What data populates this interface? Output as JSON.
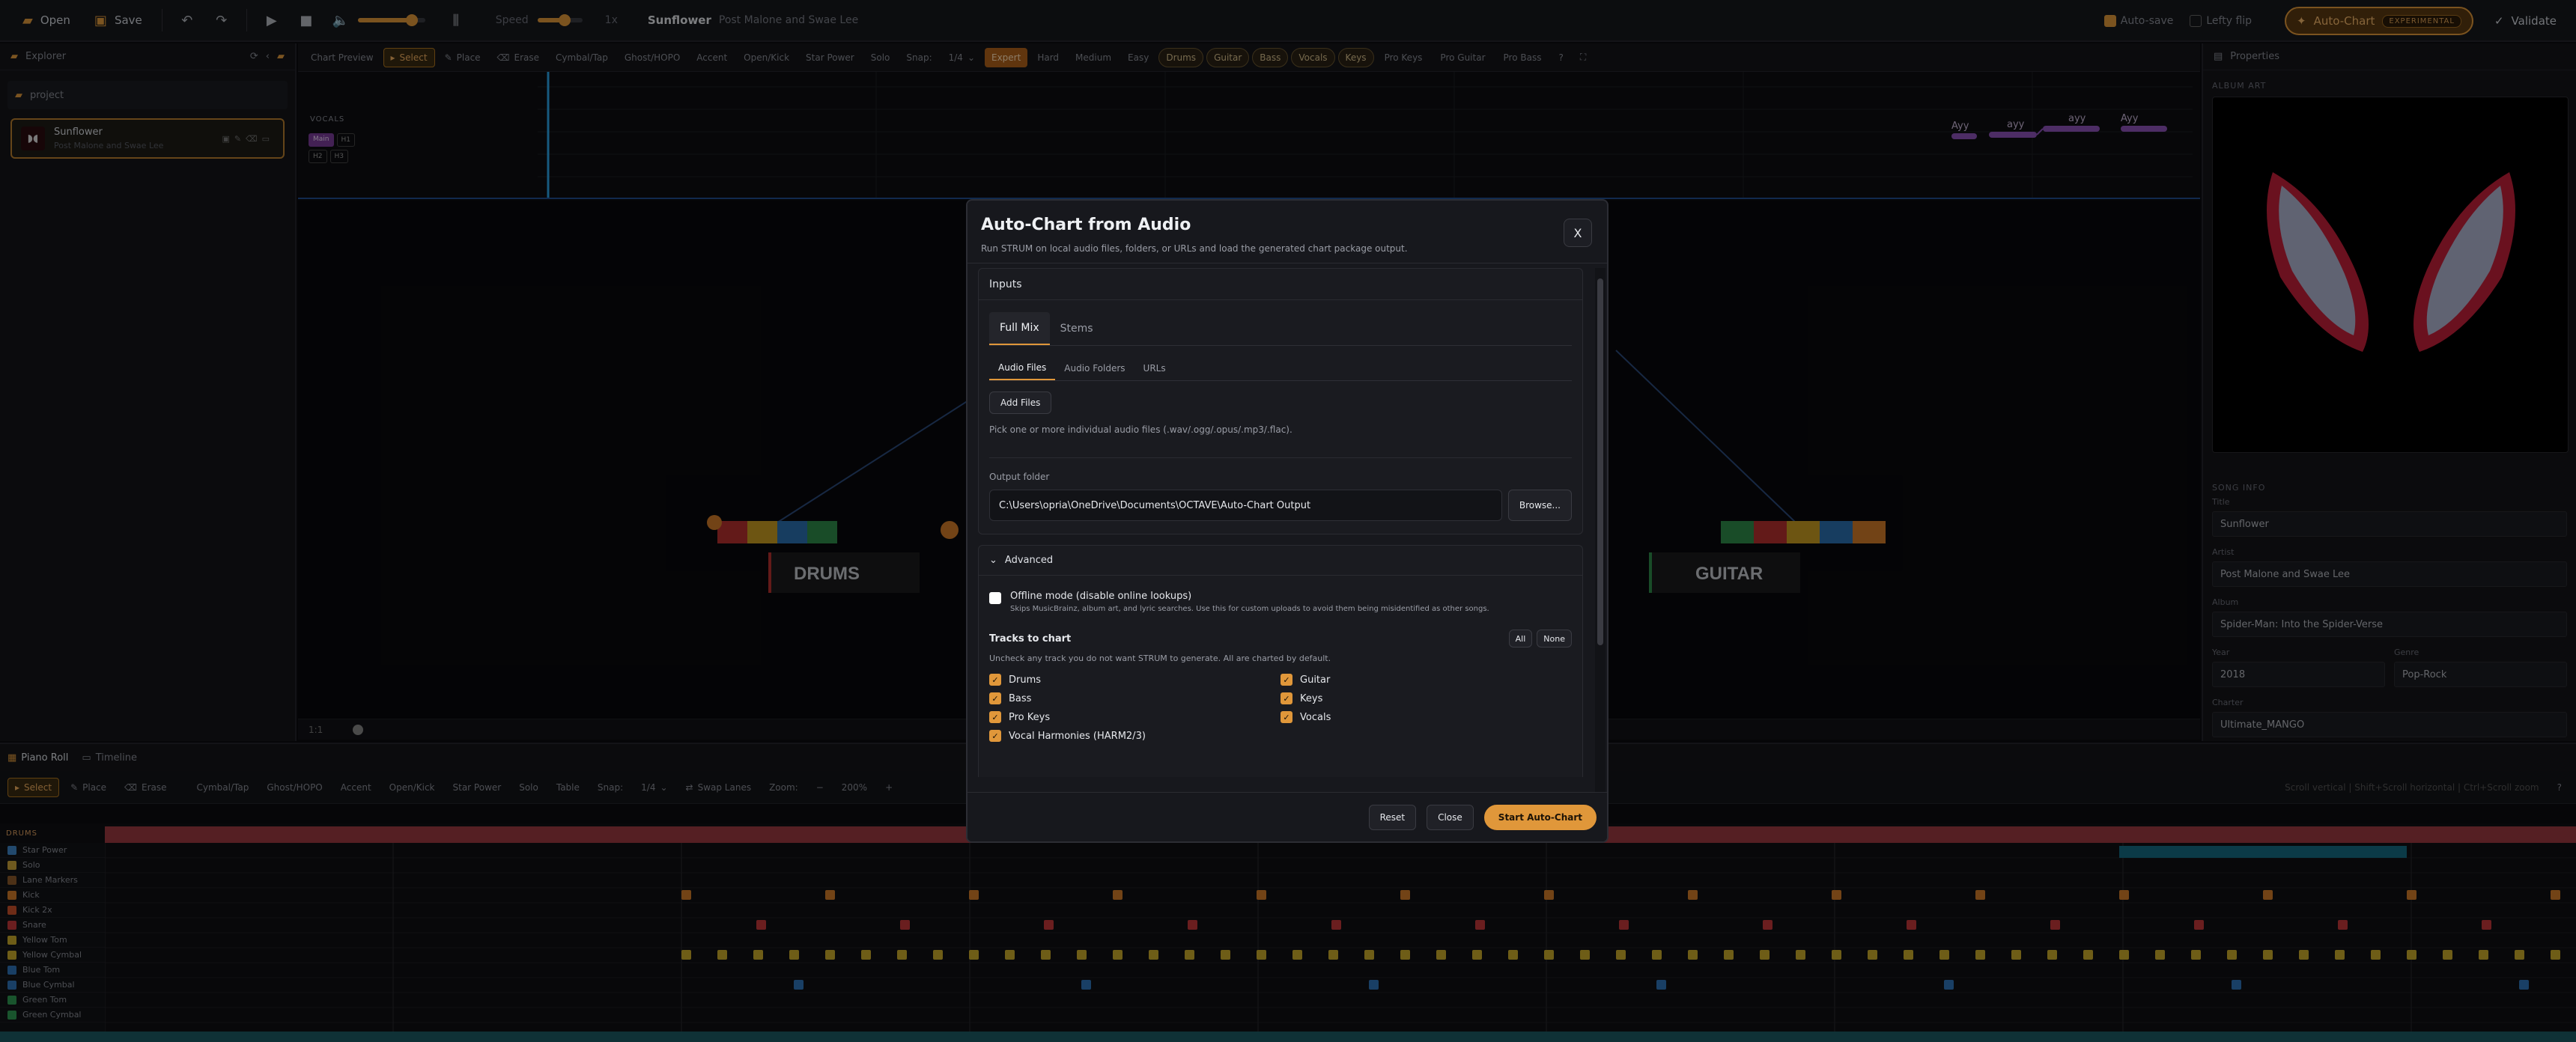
{
  "topbar": {
    "open": "Open",
    "save": "Save",
    "speed_label": "Speed",
    "speed_value": "1x",
    "song_title": "Sunflower",
    "song_artist": "Post Malone and Swae Lee",
    "auto_save": "Auto-save",
    "lefty_flip": "Lefty flip",
    "auto_chart": "Auto-Chart",
    "experimental": "EXPERIMENTAL",
    "validate": "Validate"
  },
  "explorer": {
    "title": "Explorer",
    "folder": "project",
    "song_title": "Sunflower",
    "song_artist": "Post Malone and Swae Lee"
  },
  "chartbar": {
    "title": "Chart Preview",
    "select": "Select",
    "place": "Place",
    "erase": "Erase",
    "cymbal_tap": "Cymbal/Tap",
    "ghost_hopo": "Ghost/HOPO",
    "accent": "Accent",
    "open_kick": "Open/Kick",
    "star_power": "Star Power",
    "solo": "Solo",
    "snap": "Snap:",
    "snap_value": "1/4",
    "expert": "Expert",
    "hard": "Hard",
    "medium": "Medium",
    "easy": "Easy",
    "tracks": [
      "Drums",
      "Guitar",
      "Bass",
      "Vocals",
      "Keys"
    ],
    "tracks_off": [
      "Pro Keys",
      "Pro Guitar",
      "Pro Bass"
    ]
  },
  "vocals": {
    "label": "VOCALS",
    "main": "Main",
    "h1": "H1",
    "h2": "H2",
    "h3": "H3",
    "lyrics": [
      "Ayy",
      "ayy",
      "ayy",
      "Ayy"
    ]
  },
  "highway": {
    "left": "DRUMS",
    "right": "GUITAR",
    "zoom": "1:1"
  },
  "props": {
    "title": "Properties",
    "album_art": "ALBUM ART",
    "song_info": "SONG INFO",
    "title_label": "Title",
    "title_value": "Sunflower",
    "artist_label": "Artist",
    "artist_value": "Post Malone and Swae Lee",
    "album_label": "Album",
    "album_value": "Spider-Man: Into the Spider-Verse",
    "year_label": "Year",
    "year_value": "2018",
    "genre_label": "Genre",
    "genre_value": "Pop-Rock",
    "charter_label": "Charter",
    "charter_value": "Ultimate_MANGO"
  },
  "bottom": {
    "piano_roll": "Piano Roll",
    "timeline": "Timeline",
    "select": "Select",
    "place": "Place",
    "erase": "Erase",
    "cymbal_tap": "Cymbal/Tap",
    "ghost_hopo": "Ghost/HOPO",
    "accent": "Accent",
    "open_kick": "Open/Kick",
    "star_power": "Star Power",
    "solo": "Solo",
    "table": "Table",
    "snap": "Snap:",
    "snap_value": "1/4",
    "swap_lanes": "Swap Lanes",
    "zoom": "Zoom:",
    "zoom_value": "200%",
    "hint": "Scroll vertical | Shift+Scroll horizontal | Ctrl+Scroll zoom",
    "section": "DRUMS",
    "lanes": [
      "Star Power",
      "Solo",
      "Lane Markers",
      "Kick",
      "Kick 2x",
      "Snare",
      "Yellow Tom",
      "Yellow Cymbal",
      "Blue Tom",
      "Blue Cymbal",
      "Green Tom",
      "Green Cymbal"
    ],
    "lane_colors": [
      "#3f86c7",
      "#c9a23a",
      "#8a5a2a",
      "#d07a28",
      "#c8502a",
      "#c2373a",
      "#c8aa2a",
      "#c8aa2a",
      "#2e73b8",
      "#2e73b8",
      "#2f9a52",
      "#2f9a52"
    ]
  },
  "modal": {
    "title": "Auto-Chart from Audio",
    "subtitle": "Run STRUM on local audio files, folders, or URLs and load the generated chart package output.",
    "close_x": "X",
    "inputs": "Inputs",
    "tab_full_mix": "Full Mix",
    "tab_stems": "Stems",
    "sub_files": "Audio Files",
    "sub_folders": "Audio Folders",
    "sub_urls": "URLs",
    "add_files": "Add Files",
    "add_hint": "Pick one or more individual audio files (.wav/.ogg/.opus/.mp3/.flac).",
    "output_label": "Output folder",
    "output_value": "C:\\Users\\opria\\OneDrive\\Documents\\OCTAVE\\Auto-Chart Output",
    "browse": "Browse...",
    "advanced": "Advanced",
    "offline_title": "Offline mode (disable online lookups)",
    "offline_desc": "Skips MusicBrainz, album art, and lyric searches. Use this for custom uploads to avoid them being misidentified as other songs.",
    "tracks_title": "Tracks to chart",
    "all": "All",
    "none": "None",
    "tracks_desc": "Uncheck any track you do not want STRUM to generate. All are charted by default.",
    "tracks": [
      "Drums",
      "Guitar",
      "Bass",
      "Keys",
      "Pro Keys",
      "Vocals",
      "Vocal Harmonies (HARM2/3)"
    ],
    "reset": "Reset",
    "close": "Close",
    "start": "Start Auto-Chart"
  }
}
